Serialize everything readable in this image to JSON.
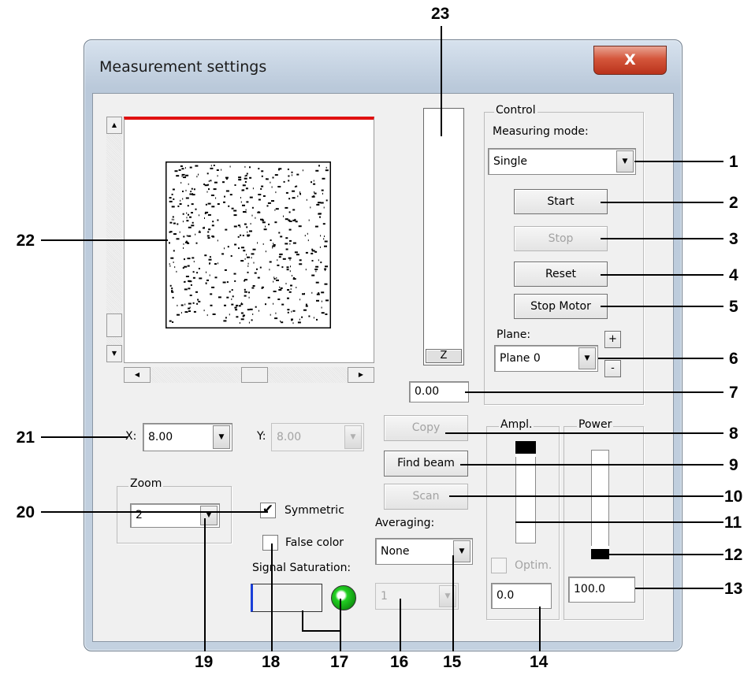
{
  "window": {
    "title": "Measurement settings",
    "close_label": "X"
  },
  "preview": {
    "z_button_label": "Z",
    "z_value": "0.00",
    "accent_color": "#e01010"
  },
  "control": {
    "group_label": "Control",
    "measuring_mode_label": "Measuring mode:",
    "measuring_mode_value": "Single",
    "start_label": "Start",
    "stop_label": "Stop",
    "reset_label": "Reset",
    "stop_motor_label": "Stop Motor",
    "plane_label": "Plane:",
    "plane_value": "Plane 0",
    "plane_plus": "+",
    "plane_minus": "-"
  },
  "coords": {
    "x_label": "X:",
    "x_value": "8.00",
    "y_label": "Y:",
    "y_value": "8.00"
  },
  "zoom": {
    "group_label": "Zoom",
    "value": "2"
  },
  "options": {
    "symmetric_label": "Symmetric",
    "symmetric_checked": true,
    "false_color_label": "False color",
    "false_color_checked": false,
    "signal_saturation_label": "Signal Saturation:",
    "saturation_led_color": "#22d022"
  },
  "actions": {
    "copy_label": "Copy",
    "find_beam_label": "Find beam",
    "scan_label": "Scan",
    "averaging_label": "Averaging:",
    "averaging_value": "None",
    "averaging_count": "1"
  },
  "ampl": {
    "group_label": "Ampl.",
    "optim_label": "Optim.",
    "value": "0.0"
  },
  "power": {
    "group_label": "Power",
    "value": "100.0"
  },
  "callouts": [
    "1",
    "2",
    "3",
    "4",
    "5",
    "6",
    "7",
    "8",
    "9",
    "10",
    "11",
    "12",
    "13",
    "14",
    "15",
    "16",
    "17",
    "18",
    "19",
    "20",
    "21",
    "22",
    "23"
  ]
}
